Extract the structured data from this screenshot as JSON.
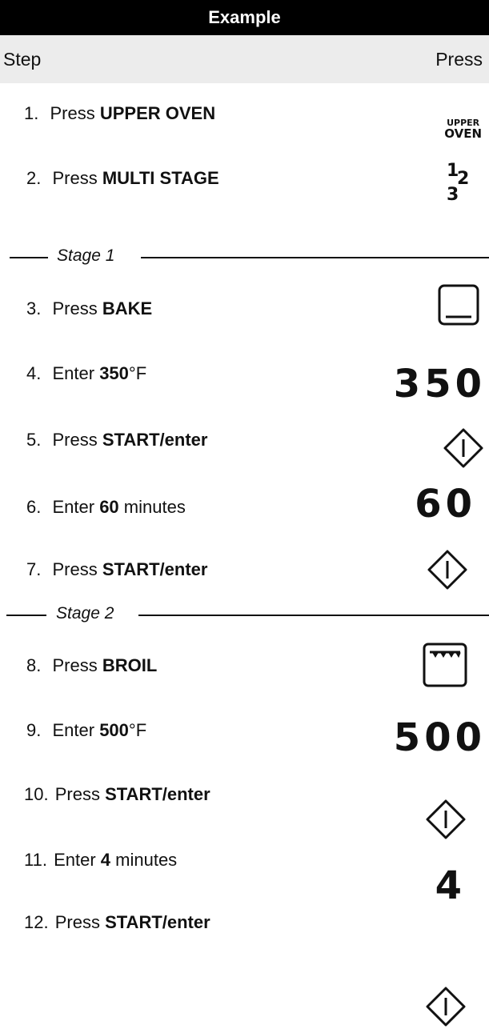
{
  "header": {
    "title": "Example"
  },
  "columns": {
    "step": "Step",
    "press": "Press"
  },
  "steps": [
    {
      "num": "1.",
      "prefix": "Press ",
      "bold": "UPPER OVEN",
      "suffix": ""
    },
    {
      "num": "2.",
      "prefix": "Press ",
      "bold": "MULTI STAGE",
      "suffix": ""
    },
    {
      "num": "3.",
      "prefix": "Press ",
      "bold": "BAKE",
      "suffix": ""
    },
    {
      "num": "4.",
      "prefix": "Enter ",
      "bold": "350",
      "suffix": "°F"
    },
    {
      "num": "5.",
      "prefix": "Press ",
      "bold": "START/enter",
      "suffix": ""
    },
    {
      "num": "6.",
      "prefix": "Enter ",
      "bold": "60",
      "suffix": " minutes"
    },
    {
      "num": "7.",
      "prefix": "Press ",
      "bold": "START/enter",
      "suffix": ""
    },
    {
      "num": "8.",
      "prefix": "Press ",
      "bold": "BROIL",
      "suffix": ""
    },
    {
      "num": "9.",
      "prefix": "Enter ",
      "bold": "500",
      "suffix": "°F"
    },
    {
      "num": "10.",
      "prefix": "Press ",
      "bold": "START/enter",
      "suffix": ""
    },
    {
      "num": "11.",
      "prefix": "Enter ",
      "bold": "4",
      "suffix": " minutes"
    },
    {
      "num": "12.",
      "prefix": "Press ",
      "bold": "START/enter",
      "suffix": ""
    }
  ],
  "stages": [
    {
      "label": "Stage 1"
    },
    {
      "label": "Stage 2"
    }
  ],
  "keys": {
    "upper_oven_line1": "UPPER",
    "upper_oven_line2": "OVEN",
    "multi_stage_digits": [
      "1",
      "2",
      "3"
    ],
    "display_350": "350",
    "display_60": "60",
    "display_500": "500",
    "display_4": "4"
  },
  "icons": {
    "multi_stage": "multi-stage-icon",
    "bake": "bake-icon",
    "broil": "broil-icon",
    "start": "start-enter-icon"
  }
}
